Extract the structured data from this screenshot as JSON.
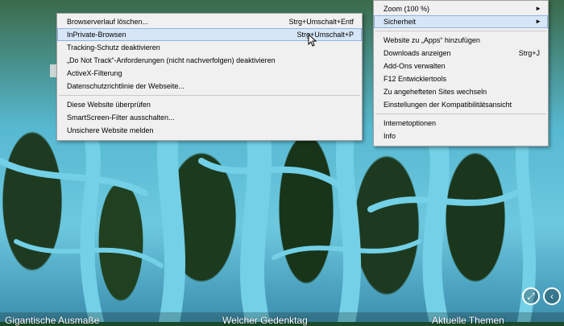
{
  "main_menu": {
    "items": [
      {
        "label": "Zoom (100 %)",
        "submenu": true
      },
      {
        "label": "Sicherheit",
        "submenu": true,
        "highlighted": true
      },
      {
        "separator": true
      },
      {
        "label": "Website zu „Apps“ hinzufügen"
      },
      {
        "label": "Downloads anzeigen",
        "shortcut": "Strg+J"
      },
      {
        "label": "Add-Ons verwalten"
      },
      {
        "label": "F12 Entwicklertools"
      },
      {
        "label": "Zu angehefteten Sites wechseln"
      },
      {
        "label": "Einstellungen der Kompatibilitätsansicht"
      },
      {
        "separator": true
      },
      {
        "label": "Internetoptionen"
      },
      {
        "label": "Info"
      }
    ]
  },
  "sub_menu": {
    "items": [
      {
        "label": "Browserverlauf löschen...",
        "shortcut": "Strg+Umschalt+Entf"
      },
      {
        "label": "InPrivate-Browsen",
        "shortcut": "Strg+Umschalt+P",
        "highlighted": true
      },
      {
        "label": "Tracking-Schutz deaktivieren"
      },
      {
        "label": "„Do Not Track“-Anforderungen (nicht nachverfolgen) deaktivieren"
      },
      {
        "label": "ActiveX-Filterung"
      },
      {
        "label": "Datenschutzrichtlinie der Webseite..."
      },
      {
        "separator": true
      },
      {
        "label": "Diese Website überprüfen"
      },
      {
        "label": "SmartScreen-Filter ausschalten..."
      },
      {
        "label": "Unsichere Website melden"
      }
    ]
  },
  "bottom_bar": {
    "links": [
      "Gigantische Ausmaße",
      "Welcher Gedenktag",
      "Aktuelle Themen"
    ]
  },
  "icons": {
    "fullscreen": "expand-icon",
    "previous": "chevron-left-icon",
    "submenu_arrow": "triangle-right-icon"
  }
}
